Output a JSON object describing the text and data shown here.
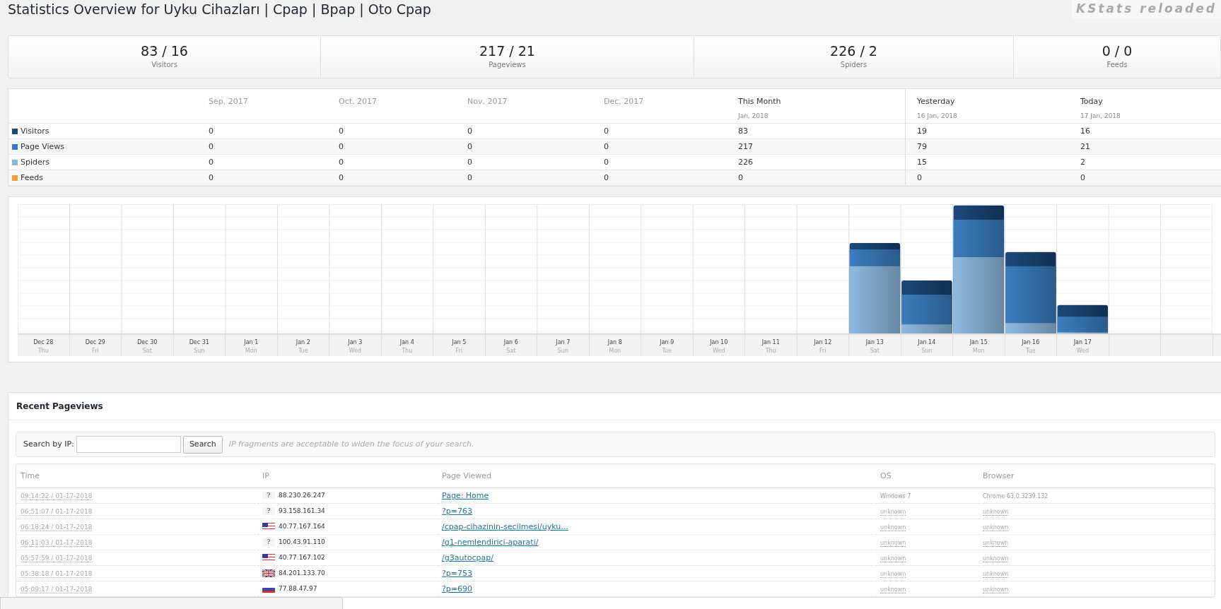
{
  "page": {
    "title": "Statistics Overview for Uyku Cihazları | Cpap | Bpap | Oto Cpap",
    "logo": "KStats reloaded"
  },
  "summary": [
    {
      "value": "83 / 16",
      "label": "Visitors"
    },
    {
      "value": "217 / 21",
      "label": "Pageviews"
    },
    {
      "value": "226 / 2",
      "label": "Spiders"
    },
    {
      "value": "0 / 0",
      "label": "Feeds"
    }
  ],
  "overview": {
    "columns": [
      {
        "label": "Sep, 2017"
      },
      {
        "label": "Oct, 2017"
      },
      {
        "label": "Nov, 2017"
      },
      {
        "label": "Dec, 2017"
      },
      {
        "label": "This Month",
        "sub": "Jan, 2018"
      },
      {
        "label": "Yesterday",
        "sub": "16 Jan, 2018"
      },
      {
        "label": "Today",
        "sub": "17 Jan, 2018"
      }
    ],
    "rows": [
      {
        "name": "Visitors",
        "color": "#1e4a78",
        "values": [
          "0",
          "0",
          "0",
          "0",
          "83",
          "19",
          "16"
        ]
      },
      {
        "name": "Page Views",
        "color": "#3b7bbf",
        "values": [
          "0",
          "0",
          "0",
          "0",
          "217",
          "79",
          "21"
        ]
      },
      {
        "name": "Spiders",
        "color": "#8db6dd",
        "values": [
          "0",
          "0",
          "0",
          "0",
          "226",
          "15",
          "2"
        ]
      },
      {
        "name": "Feeds",
        "color": "#f59a3c",
        "values": [
          "0",
          "0",
          "0",
          "0",
          "0",
          "0",
          "0"
        ]
      }
    ]
  },
  "chart": {
    "days": [
      {
        "date": "Dec 28",
        "weekday": "Thu"
      },
      {
        "date": "Dec 29",
        "weekday": "Fri"
      },
      {
        "date": "Dec 30",
        "weekday": "Sat"
      },
      {
        "date": "Dec 31",
        "weekday": "Sun"
      },
      {
        "date": "Jan 1",
        "weekday": "Mon"
      },
      {
        "date": "Jan 2",
        "weekday": "Tue"
      },
      {
        "date": "Jan 3",
        "weekday": "Wed"
      },
      {
        "date": "Jan 4",
        "weekday": "Thu"
      },
      {
        "date": "Jan 5",
        "weekday": "Fri"
      },
      {
        "date": "Jan 6",
        "weekday": "Sat"
      },
      {
        "date": "Jan 7",
        "weekday": "Sun"
      },
      {
        "date": "Jan 8",
        "weekday": "Mon"
      },
      {
        "date": "Jan 9",
        "weekday": "Tue"
      },
      {
        "date": "Jan 10",
        "weekday": "Wed"
      },
      {
        "date": "Jan 11",
        "weekday": "Thu"
      },
      {
        "date": "Jan 12",
        "weekday": "Fri"
      },
      {
        "date": "Jan 13",
        "weekday": "Sat"
      },
      {
        "date": "Jan 14",
        "weekday": "Sun"
      },
      {
        "date": "Jan 15",
        "weekday": "Mon"
      },
      {
        "date": "Jan 16",
        "weekday": "Tue"
      },
      {
        "date": "Jan 17",
        "weekday": "Wed"
      }
    ]
  },
  "recent": {
    "title": "Recent Pageviews",
    "search_label": "Search by IP:",
    "search_button": "Search",
    "search_hint": "IP fragments are acceptable to widen the focus of your search.",
    "columns": [
      "Time",
      "IP",
      "Page Viewed",
      "OS",
      "Browser"
    ],
    "rows": [
      {
        "time": "09:14:22 / 01-17-2018",
        "flag": {
          "kind": "unknown",
          "label": "?"
        },
        "ip": "88.230.26.247",
        "page": "Page: Home",
        "os": "Windows 7",
        "os_known": true,
        "browser": "Chrome 63.0.3239.132"
      },
      {
        "time": "06:51:07 / 01-17-2018",
        "flag": {
          "kind": "unknown",
          "label": "?"
        },
        "ip": "93.158.161.34",
        "page": "?p=763",
        "os": "unknown",
        "os_known": false,
        "browser": "unknown"
      },
      {
        "time": "06:18:24 / 01-17-2018",
        "flag": {
          "kind": "us"
        },
        "ip": "40.77.167.164",
        "page": "/cpap-cihazinin-secilmesi/uyku...",
        "os": "unknown",
        "os_known": false,
        "browser": "unknown"
      },
      {
        "time": "06:11:03 / 01-17-2018",
        "flag": {
          "kind": "unknown",
          "label": "?"
        },
        "ip": "100.43.91.110",
        "page": "/g1-nemlendirici-aparati/",
        "os": "unknown",
        "os_known": false,
        "browser": "unknown"
      },
      {
        "time": "05:57:59 / 01-17-2018",
        "flag": {
          "kind": "us"
        },
        "ip": "40.77.167.102",
        "page": "/g3autocpap/",
        "os": "unknown",
        "os_known": false,
        "browser": "unknown"
      },
      {
        "time": "05:38:18 / 01-17-2018",
        "flag": {
          "kind": "gb"
        },
        "ip": "84.201.133.70",
        "page": "?p=753",
        "os": "unknown",
        "os_known": false,
        "browser": "unknown"
      },
      {
        "time": "05:09:17 / 01-17-2018",
        "flag": {
          "kind": "ru"
        },
        "ip": "77.88.47.97",
        "page": "?p=690",
        "os": "unknown",
        "os_known": false,
        "browser": "unknown"
      }
    ]
  }
}
